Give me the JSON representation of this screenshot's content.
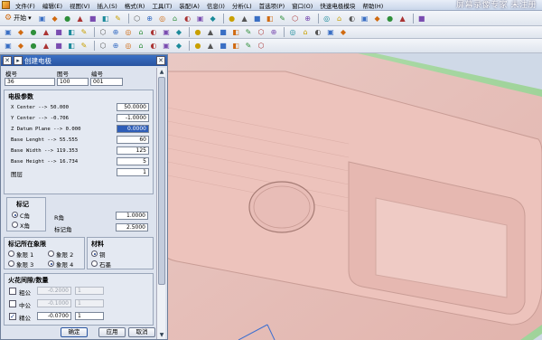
{
  "window": {
    "menu": [
      "文件(F)",
      "编辑(E)",
      "视图(V)",
      "插入(S)",
      "格式(R)",
      "工具(T)",
      "装配(A)",
      "信息(I)",
      "分析(L)",
      "首选项(P)",
      "窗口(O)",
      "快速电极模块",
      "帮助(H)"
    ],
    "watermark": "屏幕录像专家 未注册"
  },
  "toolbar": {
    "start_label": "开始",
    "row1_icons": [
      "new-icon",
      "open-icon",
      "save-icon",
      "cut-icon",
      "copy-icon",
      "paste-icon",
      "undo-icon",
      "redo-icon",
      "sketch-icon",
      "shaded-icon",
      "wireframe-icon",
      "fit-icon",
      "zoom-icon",
      "rotate-icon",
      "pan-icon",
      "view-orient-icon",
      "layer-icon",
      "color-icon",
      "edit-icon",
      "show-hide-icon",
      "line-icon",
      "arc-icon",
      "circle-icon",
      "spline-icon",
      "point-icon",
      "sphere-icon",
      "cube-icon",
      "chart-icon",
      "help-icon"
    ],
    "row2_icons": [
      "select-icon",
      "filter-icon",
      "snap-icon",
      "point-icon",
      "midpoint-icon",
      "center-icon",
      "quadrant-icon",
      "intersect-icon",
      "tangent-icon",
      "extrude-icon",
      "revolve-icon",
      "hole-icon",
      "boss-icon",
      "pad-icon",
      "blend-icon",
      "chamfer-icon",
      "shell-icon",
      "trim-icon",
      "offset-icon",
      "mirror-icon",
      "pattern-icon",
      "unite-icon",
      "subtract-icon",
      "intersect-body-icon",
      "measure-icon",
      "analysis-icon"
    ],
    "row3_icons": [
      "electrode-icon",
      "assembly-icon",
      "part-icon",
      "body-icon",
      "face-icon",
      "edge-icon",
      "curve-icon",
      "surface-icon",
      "draft-icon",
      "split-icon",
      "move-icon",
      "copy-obj-icon",
      "rename-icon",
      "grid-icon",
      "lock-icon",
      "settings-icon",
      "export-icon",
      "print-icon",
      "report-icon",
      "close-icon"
    ]
  },
  "dialog": {
    "title": "创建电极",
    "header_labels": {
      "model": "模号",
      "drawing": "图号",
      "number": "编号"
    },
    "header_values": {
      "model": "36",
      "drawing": "100",
      "number": "001"
    },
    "params_title": "电极参数",
    "params": [
      {
        "label": "X Center --> 50.000",
        "value": "50.0000"
      },
      {
        "label": "Y Center --> -0.706",
        "value": "-1.0000"
      },
      {
        "label": "Z Datum Plane --> 0.000",
        "value": "0.0000"
      },
      {
        "label": "Base Lenght --> 55.555",
        "value": "60"
      },
      {
        "label": "Base Width --> 119.353",
        "value": "125"
      },
      {
        "label": "Base Height --> 16.734",
        "value": "5"
      },
      {
        "label": "图层",
        "value": "1"
      }
    ],
    "mark": {
      "title": "标记",
      "options": [
        "C角",
        "X角"
      ],
      "selected": 0,
      "r_label": "R角",
      "r_value": "1.0000",
      "mark_angle_label": "标记角",
      "mark_angle_value": "2.5000"
    },
    "quadrant": {
      "title": "标记所在象限",
      "options": [
        "象限 1",
        "象限 2",
        "象限 3",
        "象限 4"
      ],
      "selected": 3
    },
    "material": {
      "title": "材料",
      "options": [
        "铜",
        "石墨"
      ],
      "selected": 0
    },
    "spark": {
      "title": "火花间隙/数量",
      "rows": [
        {
          "label": "粗公",
          "gap": "-0.2000",
          "qty": "1",
          "checked": false
        },
        {
          "label": "中公",
          "gap": "-0.1000",
          "qty": "1",
          "checked": false
        },
        {
          "label": "精公",
          "gap": "-0.0700",
          "qty": "1",
          "checked": true
        }
      ]
    },
    "buttons": {
      "ok": "确定",
      "apply": "应用",
      "cancel": "取消"
    }
  }
}
